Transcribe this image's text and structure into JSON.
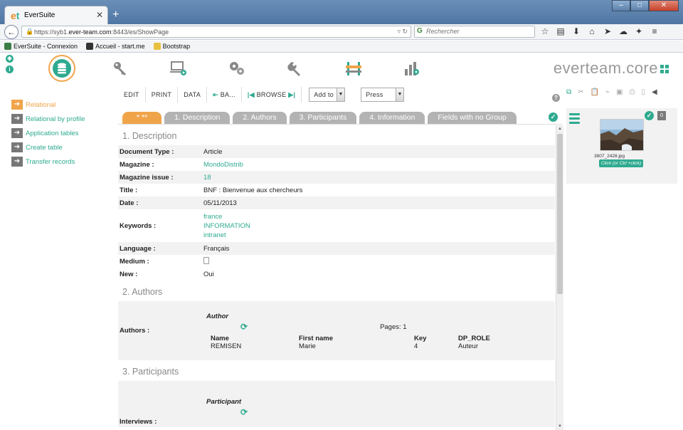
{
  "browser": {
    "tab_title": "EverSuite",
    "tab_logo": "et",
    "url_host": "https://syb1.",
    "url_domain": "ever-team.com",
    "url_path": ":8443/es/ShowPage",
    "search_placeholder": "Rechercher",
    "bookmarks": [
      {
        "label": "EverSuite - Connexion",
        "color": "#3a7d44"
      },
      {
        "label": "Accueil - start.me",
        "color": "#333333"
      },
      {
        "label": "Bootstrap",
        "color": "#e8c040"
      }
    ]
  },
  "app": {
    "brand": "everteam.core",
    "accent": "#2eaa8f",
    "highlight": "#f0a44a",
    "modules": [
      "database-icon",
      "key-icon",
      "monitor-settings-icon",
      "gears-icon",
      "wrench-icon",
      "barrier-icon",
      "chart-settings-icon"
    ],
    "nav": [
      {
        "label": "Relational",
        "active": true
      },
      {
        "label": "Relational by profile"
      },
      {
        "label": "Application tables"
      },
      {
        "label": "Create table"
      },
      {
        "label": "Transfer records"
      }
    ],
    "toolbar": {
      "edit": "EDIT",
      "print": "PRINT",
      "data": "DATA",
      "back": "BA...",
      "browse": "BROWSE",
      "add_to": "Add to",
      "press": "Press"
    },
    "tabs": [
      "* **",
      "1. Description",
      "2. Authors",
      "3. Participants",
      "4. Information",
      "Fields with no Group"
    ],
    "sections": {
      "description": "1. Description",
      "authors": "2. Authors",
      "participants": "3. Participants"
    },
    "fields": {
      "doctype_label": "Document Type :",
      "doctype_value": "Article",
      "magazine_label": "Magazine :",
      "magazine_value": "MondoDistrib",
      "issue_label": "Magazine issue :",
      "issue_value": "18",
      "title_label": "Title :",
      "title_value": "BNF : Bienvenue aux chercheurs",
      "date_label": "Date :",
      "date_value": "05/11/2013",
      "keywords_label": "Keywords :",
      "keywords": [
        "france",
        "INFORMATION",
        "intranet"
      ],
      "language_label": "Language :",
      "language_value": "Français",
      "medium_label": "Medium :",
      "new_label": "New :",
      "new_value": "Oui"
    },
    "authors": {
      "label": "Authors :",
      "title": "Author",
      "pages": "Pages: 1",
      "headers": [
        "Name",
        "First name",
        "Key",
        "DP_ROLE"
      ],
      "rows": [
        [
          "REMISEN",
          "Marie",
          "4",
          "Auteur"
        ]
      ]
    },
    "participants": {
      "label": "Interviews :",
      "title": "Participant"
    },
    "attachment": {
      "filename": "3807_2428.jpg",
      "button": "Click (or Ctrl +click)",
      "count": "0"
    }
  }
}
